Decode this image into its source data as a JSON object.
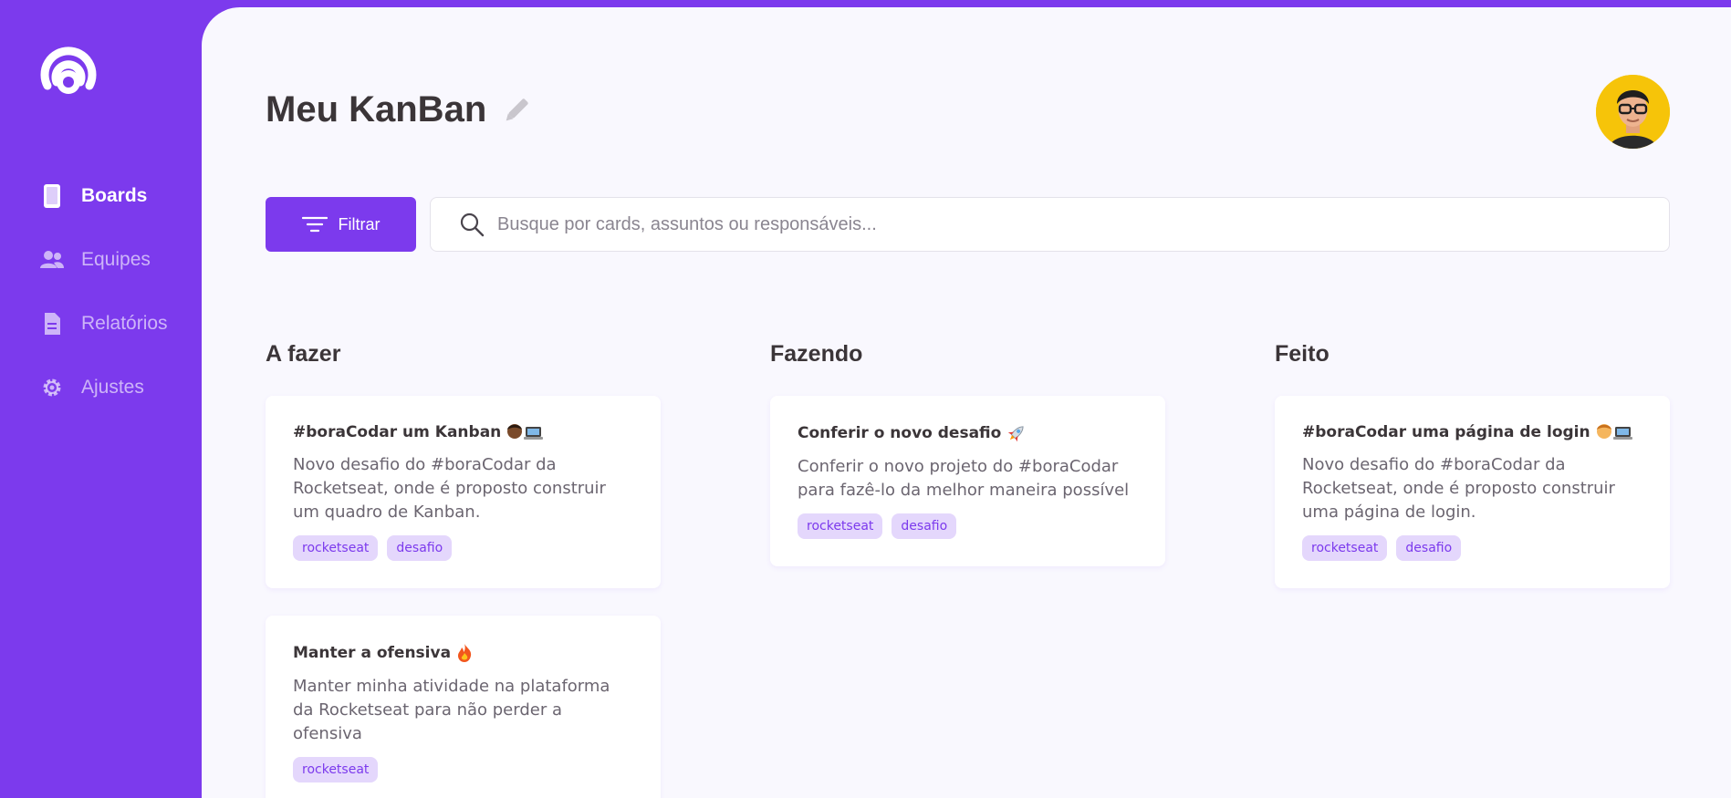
{
  "brand": {
    "accent": "#7c3aed",
    "logo_icon": "rocketseat-logo-icon"
  },
  "sidebar": {
    "items": [
      {
        "label": "Boards",
        "icon": "tablet-icon",
        "active": true
      },
      {
        "label": "Equipes",
        "icon": "users-icon",
        "active": false
      },
      {
        "label": "Relatórios",
        "icon": "document-icon",
        "active": false
      },
      {
        "label": "Ajustes",
        "icon": "gear-icon",
        "active": false
      }
    ]
  },
  "header": {
    "title": "Meu KanBan",
    "edit_icon": "pencil-icon",
    "avatar": "user-avatar"
  },
  "toolbar": {
    "filter_label": "Filtrar",
    "search_placeholder": "Busque por cards, assuntos ou responsáveis...",
    "search_value": ""
  },
  "columns": [
    {
      "title": "A fazer",
      "cards": [
        {
          "title": "#boraCodar um Kanban",
          "emoji": "🧑🏾💻",
          "description": "Novo desafio do #boraCodar da Rocketseat, onde é proposto construir um quadro de Kanban.",
          "tags": [
            "rocketseat",
            "desafio"
          ]
        },
        {
          "title": "Manter a ofensiva",
          "emoji": "🔥",
          "description": "Manter minha atividade na plataforma da Rocketseat para não perder a ofensiva",
          "tags": [
            "rocketseat"
          ]
        }
      ]
    },
    {
      "title": "Fazendo",
      "cards": [
        {
          "title": "Conferir o novo desafio",
          "emoji": "🚀",
          "description": "Conferir o novo projeto do #boraCodar para fazê-lo da melhor maneira possível",
          "tags": [
            "rocketseat",
            "desafio"
          ]
        }
      ]
    },
    {
      "title": "Feito",
      "cards": [
        {
          "title": "#boraCodar uma página de login",
          "emoji": "🧑💻",
          "description": "Novo desafio do #boraCodar da Rocketseat, onde é proposto construir uma página de login.",
          "tags": [
            "rocketseat",
            "desafio"
          ]
        }
      ]
    }
  ]
}
